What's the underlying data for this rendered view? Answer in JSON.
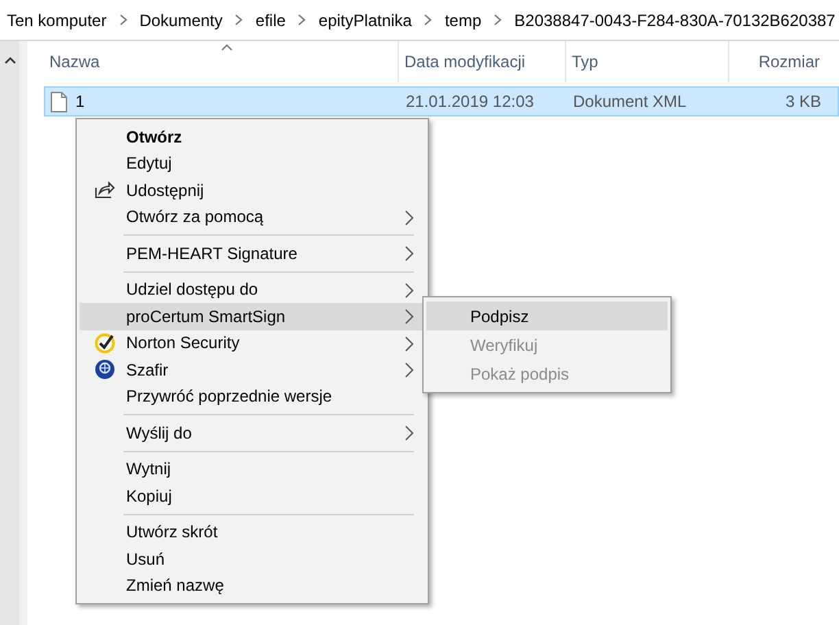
{
  "breadcrumb": [
    "Ten komputer",
    "Dokumenty",
    "efile",
    "epityPlatnika",
    "temp",
    "B2038847-0043-F284-830A-70132B620387"
  ],
  "columns": [
    {
      "label": "Nazwa",
      "sorted": true
    },
    {
      "label": "Data modyfikacji",
      "sorted": false
    },
    {
      "label": "Typ",
      "sorted": false
    },
    {
      "label": "Rozmiar",
      "sorted": false
    }
  ],
  "rows": [
    {
      "name": "1",
      "modified": "21.01.2019 12:03",
      "type": "Dokument XML",
      "size": "3 KB",
      "selected": true
    }
  ],
  "context_menu": {
    "groups": [
      [
        {
          "label": "Otwórz",
          "default": true,
          "has_submenu": false,
          "selected": false
        },
        {
          "label": "Edytuj",
          "default": false,
          "has_submenu": false,
          "selected": false
        },
        {
          "label": "Udostępnij",
          "default": false,
          "has_submenu": false,
          "selected": false
        },
        {
          "label": "Otwórz za pomocą",
          "default": false,
          "has_submenu": true,
          "selected": false
        }
      ],
      [
        {
          "label": "PEM-HEART Signature",
          "default": false,
          "has_submenu": true,
          "selected": false
        }
      ],
      [
        {
          "label": "Udziel dostępu do",
          "default": false,
          "has_submenu": true,
          "selected": false
        },
        {
          "label": "proCertum SmartSign",
          "default": false,
          "has_submenu": true,
          "selected": true
        },
        {
          "label": "Norton Security",
          "default": false,
          "has_submenu": true,
          "selected": false
        },
        {
          "label": "Szafir",
          "default": false,
          "has_submenu": true,
          "selected": false
        },
        {
          "label": "Przywróć poprzednie wersje",
          "default": false,
          "has_submenu": false,
          "selected": false
        }
      ],
      [
        {
          "label": "Wyślij do",
          "default": false,
          "has_submenu": true,
          "selected": false
        }
      ],
      [
        {
          "label": "Wytnij",
          "default": false,
          "has_submenu": false,
          "selected": false
        },
        {
          "label": "Kopiuj",
          "default": false,
          "has_submenu": false,
          "selected": false
        }
      ],
      [
        {
          "label": "Utwórz skrót",
          "default": false,
          "has_submenu": false,
          "selected": false
        },
        {
          "label": "Usuń",
          "default": false,
          "has_submenu": false,
          "selected": false
        },
        {
          "label": "Zmień nazwę",
          "default": false,
          "has_submenu": false,
          "selected": false
        }
      ]
    ]
  },
  "submenu": [
    {
      "label": "Podpisz",
      "selected": true,
      "disabled": false
    },
    {
      "label": "Weryfikuj",
      "selected": false,
      "disabled": true
    },
    {
      "label": "Pokaż podpis",
      "selected": false,
      "disabled": true
    }
  ]
}
